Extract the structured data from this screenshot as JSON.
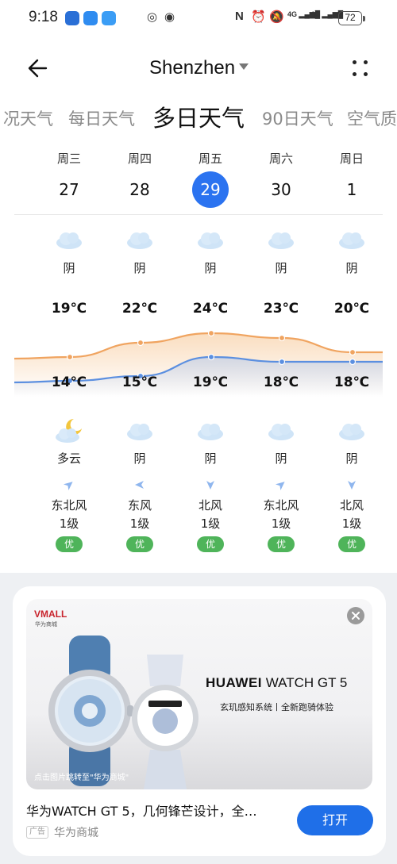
{
  "status_bar": {
    "time": "9:18",
    "net1": "4G",
    "net2": "4G",
    "battery": "72"
  },
  "header": {
    "city": "Shenzhen"
  },
  "tabs": [
    {
      "label": "况天气",
      "active": false
    },
    {
      "label": "每日天气",
      "active": false
    },
    {
      "label": "多日天气",
      "active": true
    },
    {
      "label": "90日天气",
      "active": false
    },
    {
      "label": "空气质",
      "active": false
    }
  ],
  "days": [
    {
      "weekday": "周三",
      "date": "27",
      "day_cond": "阴",
      "day_icon": "cloud-icon",
      "high": "19℃",
      "low": "14℃",
      "night_icon": "cloud-moon-icon",
      "night_cond": "多云",
      "wind_dir": "东北风",
      "wind_level": "1级",
      "aqi": "优",
      "selected": false
    },
    {
      "weekday": "周四",
      "date": "28",
      "day_cond": "阴",
      "day_icon": "cloud-icon",
      "high": "22℃",
      "low": "15℃",
      "night_icon": "cloud-icon",
      "night_cond": "阴",
      "wind_dir": "东风",
      "wind_level": "1级",
      "aqi": "优",
      "selected": false
    },
    {
      "weekday": "周五",
      "date": "29",
      "day_cond": "阴",
      "day_icon": "cloud-icon",
      "high": "24℃",
      "low": "19℃",
      "night_icon": "cloud-icon",
      "night_cond": "阴",
      "wind_dir": "北风",
      "wind_level": "1级",
      "aqi": "优",
      "selected": true
    },
    {
      "weekday": "周六",
      "date": "30",
      "day_cond": "阴",
      "day_icon": "cloud-icon",
      "high": "23℃",
      "low": "18℃",
      "night_icon": "cloud-icon",
      "night_cond": "阴",
      "wind_dir": "东北风",
      "wind_level": "1级",
      "aqi": "优",
      "selected": false
    },
    {
      "weekday": "周日",
      "date": "1",
      "day_cond": "阴",
      "day_icon": "cloud-icon",
      "high": "20℃",
      "low": "18℃",
      "night_icon": "cloud-icon",
      "night_cond": "阴",
      "wind_dir": "北风",
      "wind_level": "1级",
      "aqi": "优",
      "selected": false
    }
  ],
  "temps": {
    "highs": [
      19,
      22,
      24,
      23,
      20
    ],
    "lows": [
      14,
      15,
      19,
      18,
      18
    ]
  },
  "ad": {
    "brand_logo": "VMALL",
    "brand_logo_sub": "华为商城",
    "product_brand": "HUAWEI",
    "product_model": "WATCH GT 5",
    "tagline": "玄玑感知系统丨全新跑骑体验",
    "image_note": "点击图片跳转至\"华为商城\"",
    "title": "华为WATCH GT 5，几何锋芒设计，全…",
    "tag": "广告",
    "source": "华为商城",
    "button": "打开"
  },
  "colors": {
    "accent": "#2b73f0",
    "high_line": "#f0a460",
    "low_line": "#5b8fe0",
    "aqi_good": "#4fb45a"
  }
}
